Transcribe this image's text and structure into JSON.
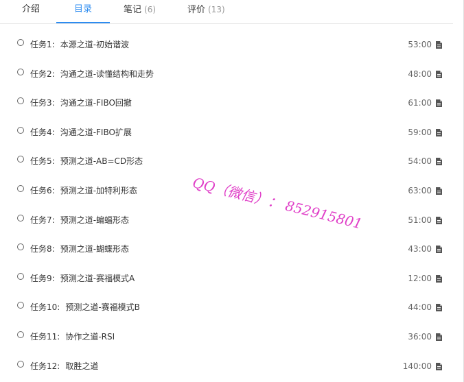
{
  "tabs": [
    {
      "label": "介绍",
      "count": "",
      "active": false
    },
    {
      "label": "目录",
      "count": "",
      "active": true
    },
    {
      "label": "笔记",
      "count": "(6)",
      "active": false
    },
    {
      "label": "评价",
      "count": "(13)",
      "active": false
    }
  ],
  "tasks": [
    {
      "no": "任务1:",
      "title": "本源之道-初始谐波",
      "duration": "53:00"
    },
    {
      "no": "任务2:",
      "title": "沟通之道-读懂结构和走势",
      "duration": "48:00"
    },
    {
      "no": "任务3:",
      "title": "沟通之道-FIBO回撤",
      "duration": "61:00"
    },
    {
      "no": "任务4:",
      "title": "沟通之道-FIBO扩展",
      "duration": "59:00"
    },
    {
      "no": "任务5:",
      "title": "预测之道-AB=CD形态",
      "duration": "54:00"
    },
    {
      "no": "任务6:",
      "title": "预测之道-加特利形态",
      "duration": "63:00"
    },
    {
      "no": "任务7:",
      "title": "预测之道-蝙蝠形态",
      "duration": "51:00"
    },
    {
      "no": "任务8:",
      "title": "预测之道-蝴蝶形态",
      "duration": "43:00"
    },
    {
      "no": "任务9:",
      "title": "预测之道-赛福模式A",
      "duration": "12:00"
    },
    {
      "no": "任务10:",
      "title": "预测之道-赛福模式B",
      "duration": "44:00"
    },
    {
      "no": "任务11:",
      "title": "协作之道-RSI",
      "duration": "36:00"
    },
    {
      "no": "任务12:",
      "title": "取胜之道",
      "duration": "140:00"
    }
  ],
  "icons": {
    "status": "radio-circle-icon",
    "type": "document-icon"
  },
  "colors": {
    "accent": "#2d8cf0",
    "watermark": "#e040c8"
  },
  "watermark": "QQ（微信）： 852915801"
}
